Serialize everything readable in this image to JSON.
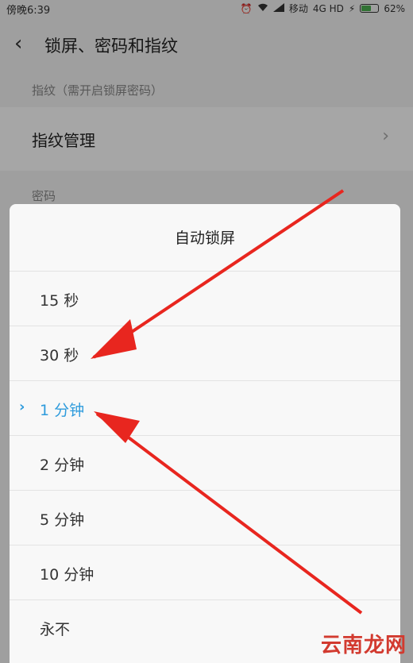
{
  "status_bar": {
    "time": "傍晚6:39",
    "carrier": "移动",
    "network": "4G HD",
    "battery_percent": "62%",
    "battery_level": 0.62
  },
  "header": {
    "back_icon": "chevron-left-icon",
    "title": "锁屏、密码和指纹"
  },
  "fingerprint_section": {
    "label": "指纹（需开启锁屏密码）",
    "item_label": "指纹管理"
  },
  "password_section": {
    "label": "密码"
  },
  "dialog": {
    "title": "自动锁屏",
    "options": [
      {
        "label": "15 秒",
        "selected": false
      },
      {
        "label": "30 秒",
        "selected": false
      },
      {
        "label": "1 分钟",
        "selected": true
      },
      {
        "label": "2 分钟",
        "selected": false
      },
      {
        "label": "5 分钟",
        "selected": false
      },
      {
        "label": "10 分钟",
        "selected": false
      },
      {
        "label": "永不",
        "selected": false
      }
    ]
  },
  "colors": {
    "accent": "#2e9bdc",
    "arrow": "#e8261f"
  },
  "watermark": "云南龙网"
}
